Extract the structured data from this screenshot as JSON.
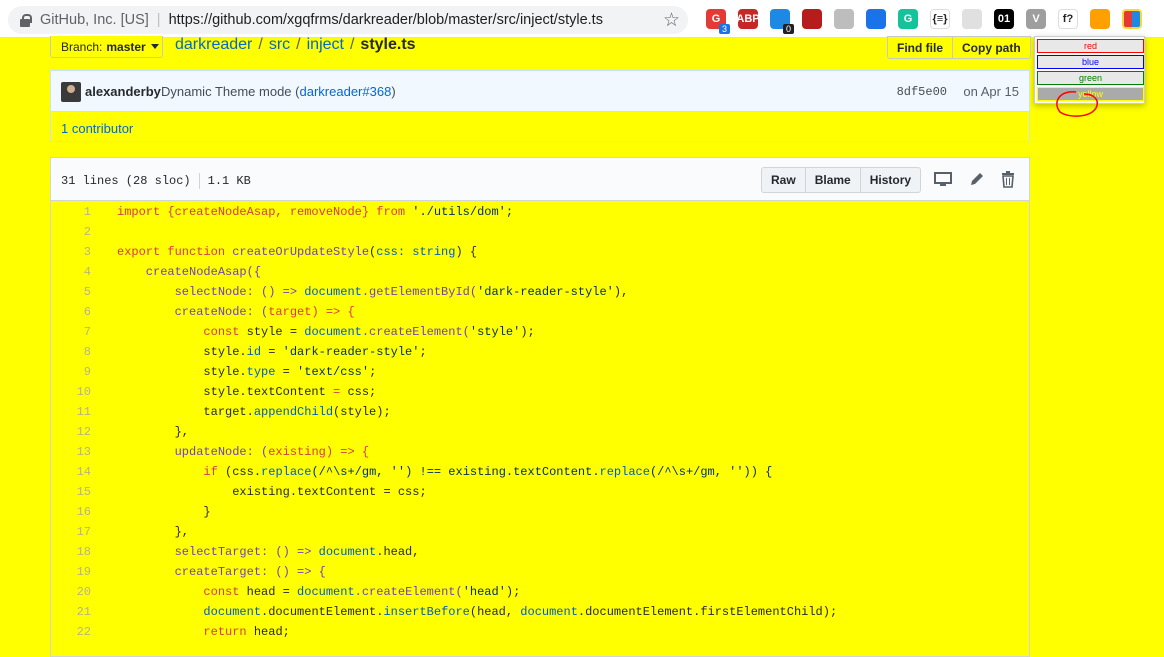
{
  "browser": {
    "site_label": "GitHub, Inc. [US]",
    "url": "https://github.com/xgqfrms/darkreader/blob/master/src/inject/style.ts",
    "extensions": [
      {
        "name": "grammar-extension-icon",
        "label": "G",
        "badge": "3",
        "color": "#e53935"
      },
      {
        "name": "adblock-plus-icon",
        "label": "ABP",
        "color": "#c62828"
      },
      {
        "name": "tracker-extension-icon",
        "label": "",
        "badge": "0",
        "color": "#1e88e5"
      },
      {
        "name": "ruby-extension-icon",
        "label": "",
        "color": "#b71c1c"
      },
      {
        "name": "stopwatch-extension-icon",
        "label": "",
        "color": "#bdbdbd"
      },
      {
        "name": "translate-extension-icon",
        "label": "",
        "color": "#1a73e8"
      },
      {
        "name": "grammarly-icon",
        "label": "G",
        "color": "#15c39a"
      },
      {
        "name": "json-extension-icon",
        "label": "{≡}",
        "color": "#ffffff"
      },
      {
        "name": "settings-extension-icon",
        "label": "",
        "color": "#e0e0e0"
      },
      {
        "name": "binary-extension-icon",
        "label": "01",
        "color": "#000000"
      },
      {
        "name": "vue-devtools-icon",
        "label": "V",
        "color": "#9e9e9e"
      },
      {
        "name": "function-extension-icon",
        "label": "f?",
        "color": "#ffffff"
      },
      {
        "name": "owl-extension-icon",
        "label": "",
        "color": "#ffa000"
      },
      {
        "name": "color-switcher-extension-icon",
        "label": "",
        "color": "#ffffff"
      }
    ]
  },
  "popup": {
    "buttons": [
      {
        "label": "red",
        "color": "#ff0000"
      },
      {
        "label": "blue",
        "color": "#0000ff"
      },
      {
        "label": "green",
        "color": "#008000"
      },
      {
        "label": "yellow",
        "color": "#ffff00"
      }
    ]
  },
  "repo": {
    "branch_prefix": "Branch:",
    "branch_name": "master",
    "crumbs": [
      "darkreader",
      "src",
      "inject"
    ],
    "file_name": "style.ts",
    "find_file": "Find file",
    "copy_path": "Copy path"
  },
  "commit": {
    "author": "alexanderby",
    "message": "Dynamic Theme mode",
    "ref_open": "(",
    "ref": "darkreader#368",
    "ref_close": ")",
    "sha": "8df5e00",
    "date": "on Apr 15",
    "contributors": "1 contributor"
  },
  "file": {
    "lines_info": "31 lines (28 sloc)",
    "size": "1.1 KB",
    "raw": "Raw",
    "blame": "Blame",
    "history": "History"
  },
  "code_lines": [
    "1",
    "2",
    "3",
    "4",
    "5",
    "6",
    "7",
    "8",
    "9",
    "10",
    "11",
    "12",
    "13",
    "14",
    "15",
    "16",
    "17",
    "18",
    "19",
    "20",
    "21",
    "22"
  ],
  "code": {
    "l1_a": "import {createNodeAsap, removeNode} ",
    "l1_b": "from",
    "l1_c": " './utils/dom';",
    "l3_a": "export function ",
    "l3_b": "createOrUpdateStyle",
    "l3_c": "(",
    "l3_d": "css: string",
    "l3_e": ") {",
    "l4": "    createNodeAsap({",
    "l5_a": "        selectNode: () => ",
    "l5_b": "document",
    "l5_c": ".getElementById(",
    "l5_d": "'dark-reader-style'",
    "l5_e": "),",
    "l6_a": "        createNode: (",
    "l6_b": "target",
    "l6_c": ") => {",
    "l7_a": "            const ",
    "l7_b": "style",
    "l7_c": " = ",
    "l7_d": "document",
    "l7_e": ".createElement(",
    "l7_f": "'style'",
    "l7_g": ");",
    "l8_a": "            style.",
    "l8_b": "id",
    "l8_c": " = ",
    "l8_d": "'dark-reader-style'",
    "l8_e": ";",
    "l9_a": "            style.",
    "l9_b": "type",
    "l9_c": " = ",
    "l9_d": "'text/css'",
    "l9_e": ";",
    "l10_a": "            style.textContent ",
    "l10_b": "=",
    "l10_c": " css;",
    "l11_a": "            target.",
    "l11_b": "appendChild",
    "l11_c": "(style);",
    "l12": "        },",
    "l13_a": "        updateNode: (",
    "l13_b": "existing",
    "l13_c": ") => {",
    "l14_a": "            if ",
    "l14_b": "(css.",
    "l14_c": "replace",
    "l14_d": "(/^\\s+/gm, '') !== existing.textContent.",
    "l14_e": "replace",
    "l14_f": "(/^\\s+/gm, '')) {",
    "l15": "                existing.textContent = css;",
    "l16": "            }",
    "l17": "        },",
    "l18_a": "        selectTarget: () => ",
    "l18_b": "document",
    "l18_c": ".head,",
    "l19": "        createTarget: () => {",
    "l20_a": "            const ",
    "l20_b": "head",
    "l20_c": " = ",
    "l20_d": "document",
    "l20_e": ".createElement(",
    "l20_f": "'head'",
    "l20_g": ");",
    "l21_a": "            ",
    "l21_b": "document",
    "l21_c": ".documentElement.",
    "l21_d": "insertBefore",
    "l21_e": "(head, ",
    "l21_f": "document",
    "l21_g": ".documentElement.firstElementChild);",
    "l22_a": "            ",
    "l22_b": "return",
    "l22_c": " head;"
  }
}
